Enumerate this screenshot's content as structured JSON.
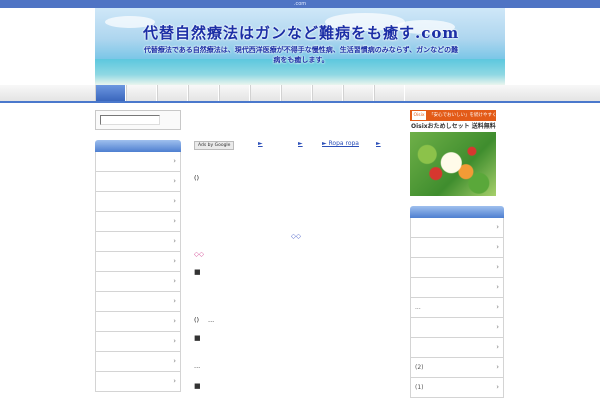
{
  "topbar": {
    "text": ".com"
  },
  "header": {
    "title": "代替自然療法はガンなど難病をも癒す.com",
    "description": "代替療法である自然療法は、現代西洋医療が不得手な慢性病、生活習慣病のみならず、ガンなどの難病をも癒します。"
  },
  "colors": {
    "accent": "#4a78cc",
    "title": "#1c2fa6",
    "link": "#2b4fb8"
  },
  "nav": {
    "tab_count": 10,
    "active_index": 0
  },
  "search": {
    "value": "",
    "placeholder": ""
  },
  "left_sidebar": {
    "items": [
      {
        "label": ""
      },
      {
        "label": ""
      },
      {
        "label": ""
      },
      {
        "label": ""
      },
      {
        "label": ""
      },
      {
        "label": ""
      },
      {
        "label": ""
      },
      {
        "label": ""
      },
      {
        "label": ""
      },
      {
        "label": ""
      },
      {
        "label": ""
      },
      {
        "label": ""
      }
    ]
  },
  "main": {
    "ads": {
      "badge": "Ads by Google",
      "links": [
        "►",
        "►",
        "► Ropa ropa",
        "►"
      ]
    },
    "texts": {
      "paren1": "()",
      "diamonds_blue": "◇◇",
      "diamonds_pink": "◇◇",
      "paren2": "()",
      "ellipsis1": "...",
      "ellipsis2": "..."
    },
    "bullets": [
      "■",
      "■",
      "■"
    ]
  },
  "banner": {
    "logo": "Oisix",
    "tagline": "「安心でおいしい」を続けやすく",
    "headline": "Oisixおためしセット 送料無料"
  },
  "right_sidebar": {
    "items": [
      {
        "label": ""
      },
      {
        "label": ""
      },
      {
        "label": ""
      },
      {
        "label": ""
      },
      {
        "label": "..."
      },
      {
        "label": ""
      },
      {
        "label": ""
      },
      {
        "label": "(2)"
      },
      {
        "label": "(1)"
      }
    ]
  }
}
